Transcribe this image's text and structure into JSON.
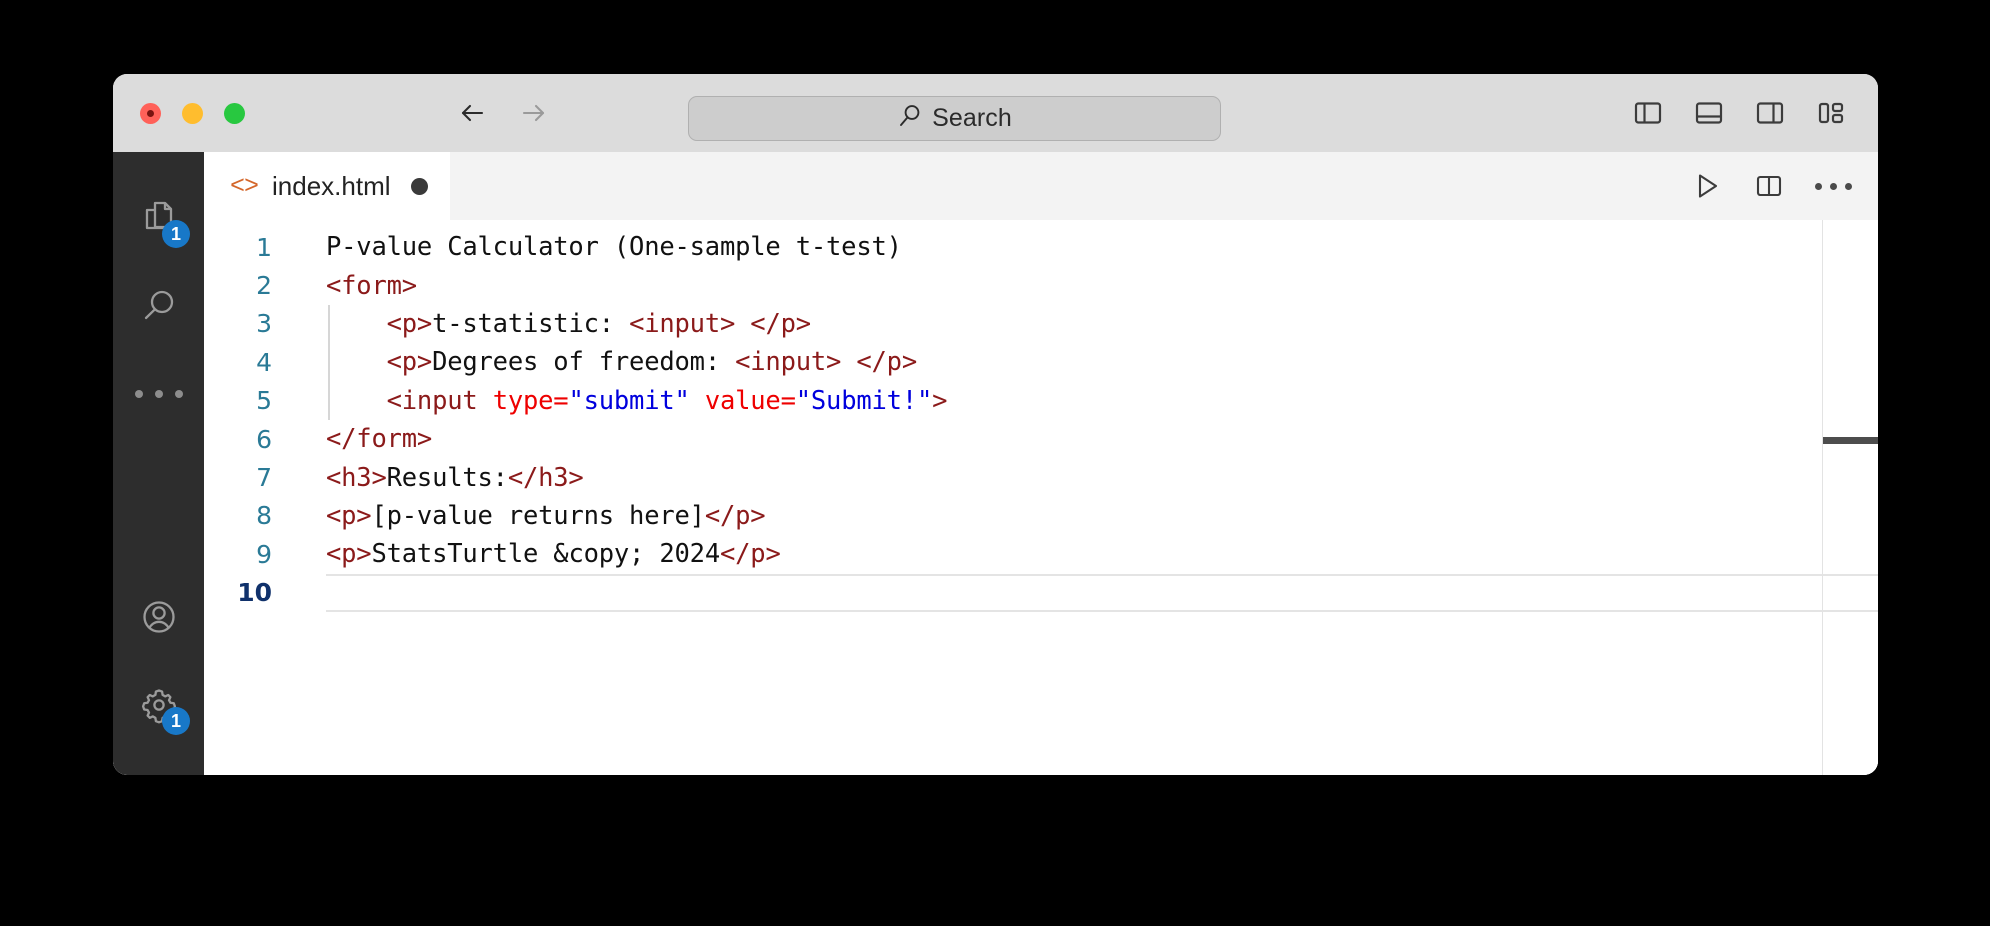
{
  "window": {
    "title_bar": {
      "traffic_lights": [
        {
          "name": "close",
          "color": "#ff6159"
        },
        {
          "name": "minimize",
          "color": "#ffbd2e"
        },
        {
          "name": "maximize",
          "color": "#28c840"
        }
      ],
      "back_label": "Back",
      "forward_label": "Forward",
      "search": {
        "label": "Search",
        "placeholder": "Search",
        "value": ""
      },
      "layout_actions": [
        {
          "name": "toggle-primary-sidebar",
          "label": "Toggle Primary Side Bar"
        },
        {
          "name": "toggle-panel",
          "label": "Toggle Panel"
        },
        {
          "name": "toggle-secondary-sidebar",
          "label": "Toggle Secondary Side Bar"
        },
        {
          "name": "customize-layout",
          "label": "Customize Layout"
        }
      ]
    }
  },
  "activity_bar": {
    "items": [
      {
        "name": "explorer",
        "label": "Explorer",
        "icon": "files-icon",
        "badge": "1"
      },
      {
        "name": "search",
        "label": "Search",
        "icon": "search-icon",
        "badge": ""
      },
      {
        "name": "more-views",
        "label": "Additional Views",
        "icon": "ellipsis-icon",
        "badge": ""
      },
      {
        "name": "accounts",
        "label": "Accounts",
        "icon": "account-icon",
        "badge": ""
      },
      {
        "name": "manage",
        "label": "Manage",
        "icon": "gear-icon",
        "badge": "1"
      }
    ]
  },
  "tab_bar": {
    "tabs": [
      {
        "name": "index-html",
        "filename": "index.html",
        "filetype_icon": "<>",
        "dirty": true,
        "active": true
      }
    ],
    "actions": [
      {
        "name": "run",
        "label": "Run or Debug"
      },
      {
        "name": "split-editor",
        "label": "Split Editor Right"
      },
      {
        "name": "more-actions",
        "label": "More Actions..."
      }
    ]
  },
  "editor": {
    "language": "html",
    "active_line": 10,
    "total_lines": 10,
    "colors": {
      "line_number": "#2a7a96",
      "active_line_number": "#10316b",
      "tag": "#8b1a1a",
      "attribute": "#ee0000",
      "attribute_value": "#0000dd",
      "text": "#111111",
      "background": "#ffffff"
    },
    "lines": [
      {
        "number": "1",
        "indent": 0,
        "tokens": [
          {
            "t": "text",
            "s": "P-value Calculator (One-sample t-test)"
          }
        ]
      },
      {
        "number": "2",
        "indent": 0,
        "tokens": [
          {
            "t": "tag",
            "s": "<form>"
          }
        ]
      },
      {
        "number": "3",
        "indent": 1,
        "tokens": [
          {
            "t": "tag",
            "s": "<p>"
          },
          {
            "t": "text",
            "s": "t-statistic: "
          },
          {
            "t": "tag",
            "s": "<input>"
          },
          {
            "t": "text",
            "s": " "
          },
          {
            "t": "tag",
            "s": "</p>"
          }
        ]
      },
      {
        "number": "4",
        "indent": 1,
        "tokens": [
          {
            "t": "tag",
            "s": "<p>"
          },
          {
            "t": "text",
            "s": "Degrees of freedom: "
          },
          {
            "t": "tag",
            "s": "<input>"
          },
          {
            "t": "text",
            "s": " "
          },
          {
            "t": "tag",
            "s": "</p>"
          }
        ]
      },
      {
        "number": "5",
        "indent": 1,
        "tokens": [
          {
            "t": "tag",
            "s": "<input "
          },
          {
            "t": "attr",
            "s": "type="
          },
          {
            "t": "val",
            "s": "\"submit\""
          },
          {
            "t": "text",
            "s": " "
          },
          {
            "t": "attr",
            "s": "value="
          },
          {
            "t": "val",
            "s": "\"Submit!\""
          },
          {
            "t": "tag",
            "s": ">"
          }
        ]
      },
      {
        "number": "6",
        "indent": 0,
        "tokens": [
          {
            "t": "tag",
            "s": "</form>"
          }
        ]
      },
      {
        "number": "7",
        "indent": 0,
        "tokens": [
          {
            "t": "tag",
            "s": "<h3>"
          },
          {
            "t": "text",
            "s": "Results:"
          },
          {
            "t": "tag",
            "s": "</h3>"
          }
        ]
      },
      {
        "number": "8",
        "indent": 0,
        "tokens": [
          {
            "t": "tag",
            "s": "<p>"
          },
          {
            "t": "text",
            "s": "[p-value returns here]"
          },
          {
            "t": "tag",
            "s": "</p>"
          }
        ]
      },
      {
        "number": "9",
        "indent": 0,
        "tokens": [
          {
            "t": "tag",
            "s": "<p>"
          },
          {
            "t": "text",
            "s": "StatsTurtle &copy; 2024"
          },
          {
            "t": "tag",
            "s": "</p>"
          }
        ]
      },
      {
        "number": "10",
        "indent": 0,
        "active": true,
        "tokens": []
      }
    ]
  }
}
